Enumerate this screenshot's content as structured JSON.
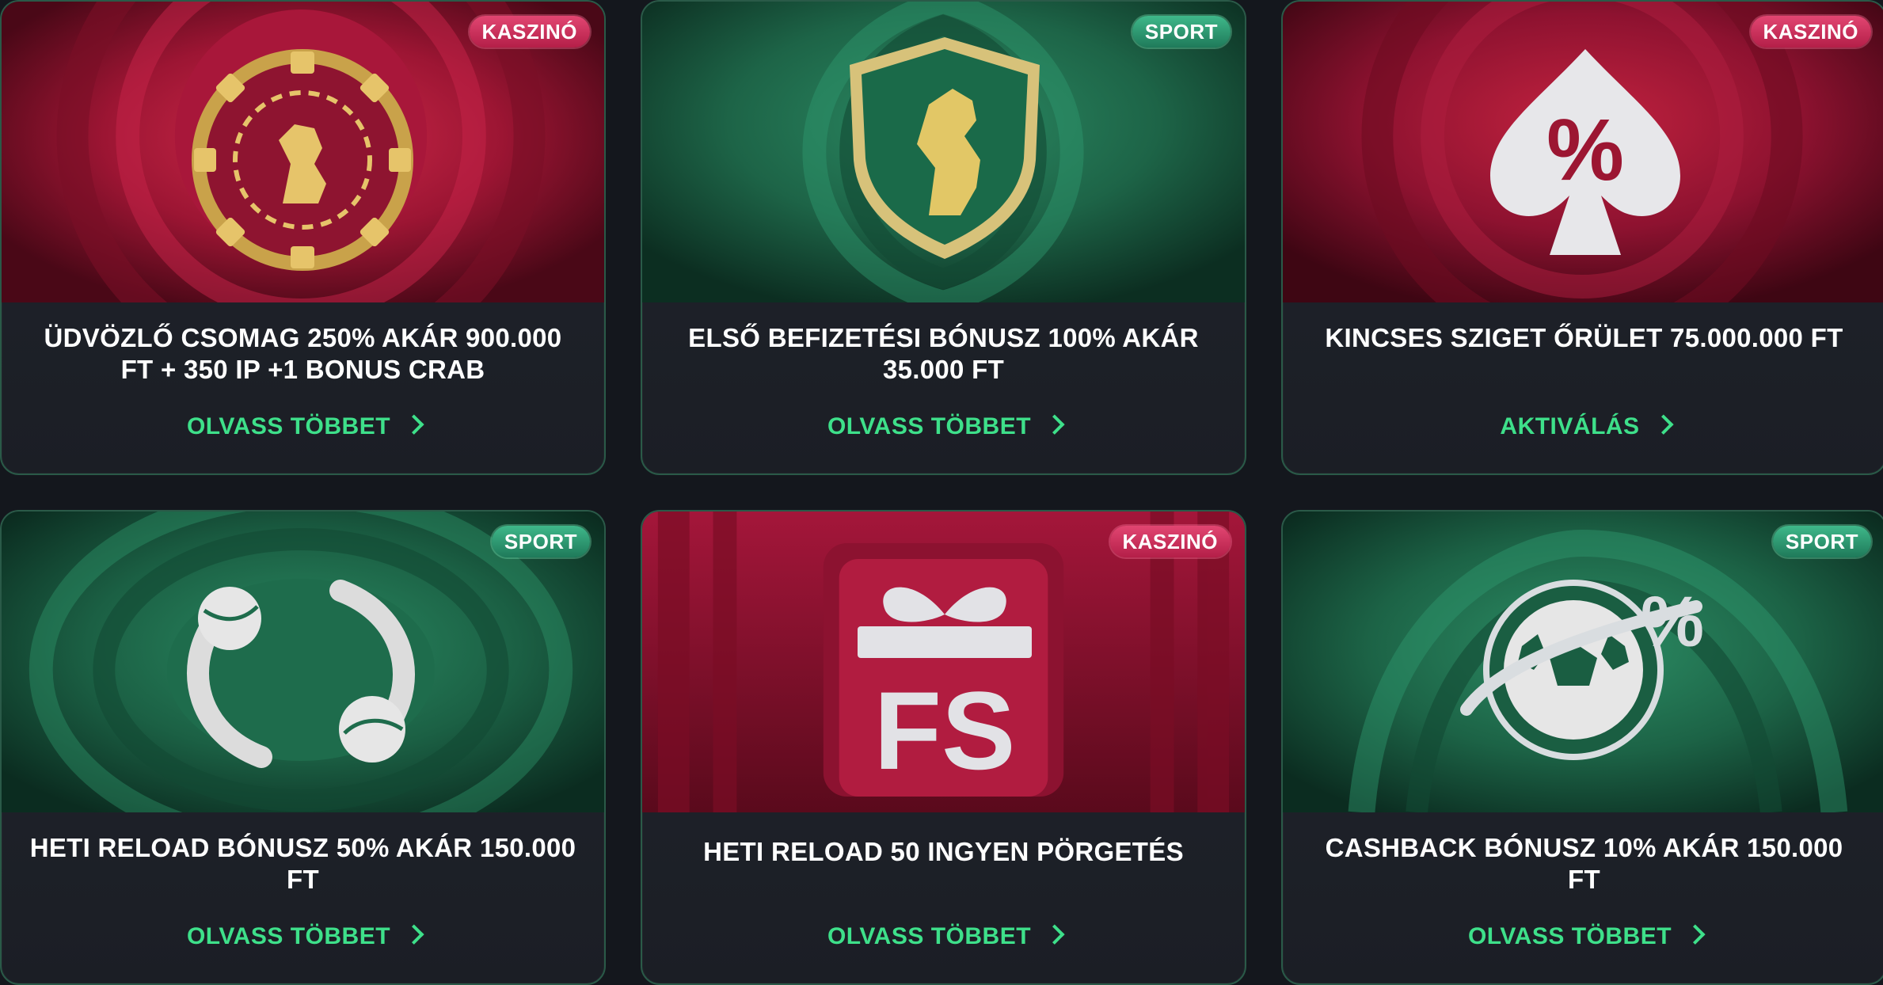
{
  "cards": [
    {
      "badge": "KASZINÓ",
      "title": "ÜDVÖZLŐ CSOMAG 250% AKÁR 900.000 FT + 350 IP +1 BONUS CRAB",
      "cta": "OLVASS TÖBBET",
      "theme": "casino",
      "icon": "casino-chip-lion-icon"
    },
    {
      "badge": "SPORT",
      "title": "ELSŐ BEFIZETÉSI BÓNUSZ 100% AKÁR 35.000 FT",
      "cta": "OLVASS TÖBBET",
      "theme": "sport",
      "icon": "lion-shield-icon"
    },
    {
      "badge": "KASZINÓ",
      "title": "KINCSES SZIGET ŐRÜLET 75.000.000 FT",
      "cta": "AKTIVÁLÁS",
      "theme": "casino",
      "icon": "spade-percent-icon"
    },
    {
      "badge": "SPORT",
      "title": "HETI RELOAD BÓNUSZ 50% AKÁR 150.000 FT",
      "cta": "OLVASS TÖBBET",
      "theme": "sport",
      "icon": "reload-balls-icon"
    },
    {
      "badge": "KASZINÓ",
      "title": "HETI RELOAD 50 INGYEN PÖRGETÉS",
      "cta": "OLVASS TÖBBET",
      "theme": "casino",
      "icon": "gift-fs-icon"
    },
    {
      "badge": "SPORT",
      "title": "CASHBACK BÓNUSZ 10% AKÁR 150.000 FT",
      "cta": "OLVASS TÖBBET",
      "theme": "sport",
      "icon": "football-percent-icon"
    }
  ],
  "colors": {
    "background": "#14171d",
    "card": "#1f232a",
    "accent_green": "#3ee08a",
    "casino_red": "#b31c3f",
    "sport_green": "#1f6b4c"
  }
}
